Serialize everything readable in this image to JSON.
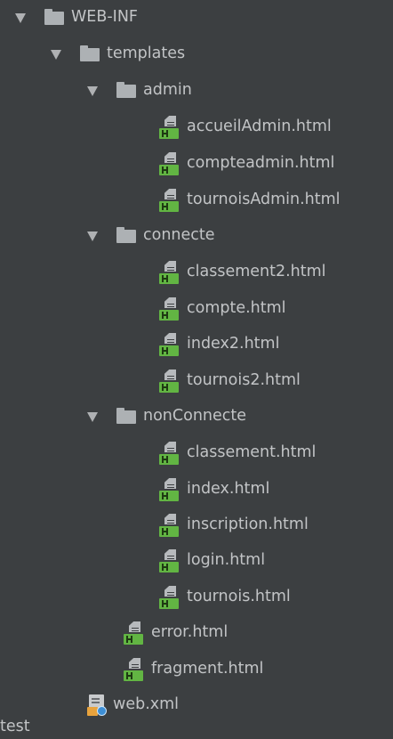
{
  "project_tree": {
    "web_inf": "WEB-INF",
    "templates": "templates",
    "admin": {
      "folder": "admin",
      "files": [
        "accueilAdmin.html",
        "compteadmin.html",
        "tournoisAdmin.html"
      ]
    },
    "connecte": {
      "folder": "connecte",
      "files": [
        "classement2.html",
        "compte.html",
        "index2.html",
        "tournois2.html"
      ]
    },
    "nonConnecte": {
      "folder": "nonConnecte",
      "files": [
        "classement.html",
        "index.html",
        "inscription.html",
        "login.html",
        "tournois.html"
      ]
    },
    "template_files": [
      "error.html",
      "fragment.html"
    ],
    "web_xml": "web.xml",
    "next_item_partial": "test"
  },
  "colors": {
    "background": "#3c3f41",
    "text": "#c2c4c6",
    "folder": "#adb1b4",
    "html_badge": "#62b543",
    "xml_badge": "#e8a33d"
  },
  "icons": {
    "expanded_arrow": "chevron-down-icon",
    "folder": "folder-icon",
    "html_file": "html-file-icon",
    "xml_file": "xml-config-file-icon"
  }
}
